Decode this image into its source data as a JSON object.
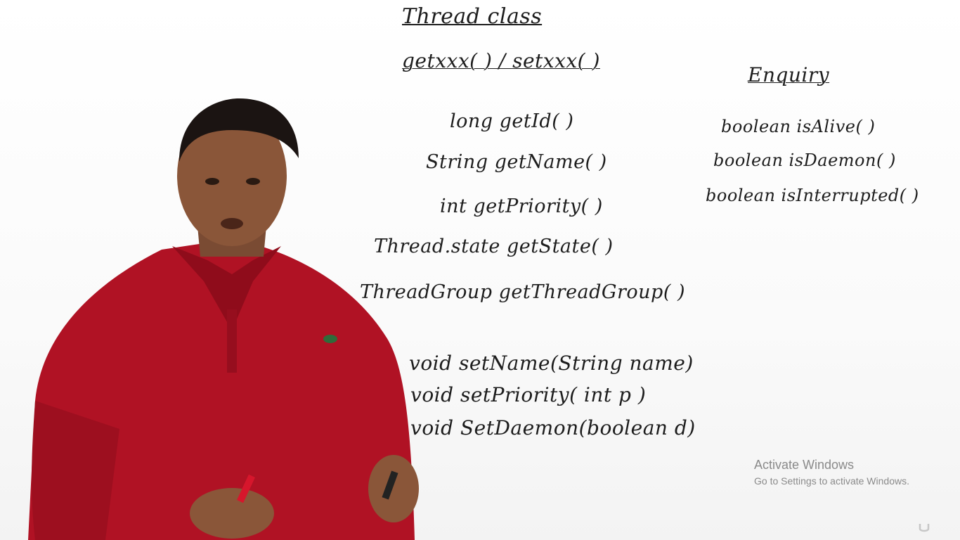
{
  "board": {
    "title": "Thread class",
    "subtitle": "getxxx( ) / setxxx( )",
    "enquiry_heading": "Enquiry",
    "getters": [
      "long  getId( )",
      "String  getName( )",
      "int   getPriority( )",
      "Thread.state  getState( )",
      "ThreadGroup   getThreadGroup( )"
    ],
    "enquiry_methods": [
      "boolean  isAlive( )",
      "boolean  isDaemon( )",
      "boolean  isInterrupted( )"
    ],
    "setters": [
      "void  setName(String name)",
      "void  setPriority( int p )",
      "void  SetDaemon(boolean d)"
    ]
  },
  "activation_notice": {
    "title": "Activate Windows",
    "subtitle": "Go to Settings to activate Windows."
  },
  "colors": {
    "shirt": "#b01224",
    "ink": "#1d1d1d",
    "board": "#fdfdfd"
  }
}
